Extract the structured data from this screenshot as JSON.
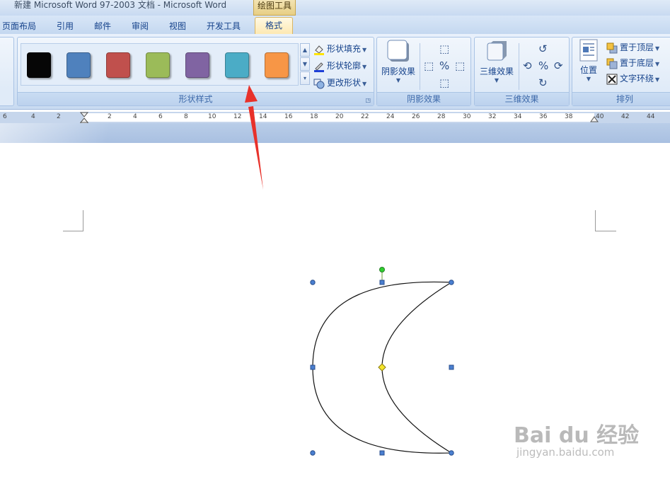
{
  "window": {
    "title": "新建 Microsoft Word 97-2003 文档 - Microsoft Word",
    "context_tool": "绘图工具"
  },
  "tabs": [
    {
      "label": "页面布局"
    },
    {
      "label": "引用"
    },
    {
      "label": "邮件"
    },
    {
      "label": "审阅"
    },
    {
      "label": "视图"
    },
    {
      "label": "开发工具"
    },
    {
      "label": "格式",
      "active": true
    }
  ],
  "ribbon": {
    "shape_styles": {
      "label": "形状样式",
      "swatches": [
        {
          "name": "black",
          "color": "#060606"
        },
        {
          "name": "blue",
          "color": "#4f81bd"
        },
        {
          "name": "red",
          "color": "#c0504d"
        },
        {
          "name": "green",
          "color": "#9bbb59"
        },
        {
          "name": "purple",
          "color": "#8064a2"
        },
        {
          "name": "aqua",
          "color": "#4bacc6"
        },
        {
          "name": "orange",
          "color": "#f79646"
        }
      ],
      "fill": "形状填充",
      "outline": "形状轮廓",
      "change_shape": "更改形状"
    },
    "shadow": {
      "label": "阴影效果",
      "button": "阴影效果"
    },
    "threed": {
      "label": "三维效果",
      "button": "三维效果"
    },
    "arrange": {
      "label": "排列",
      "position": "位置",
      "bring_front": "置于顶层",
      "send_back": "置于底层",
      "text_wrap": "文字环绕"
    }
  },
  "ruler": {
    "left_labels": [
      "6",
      "4",
      "2"
    ],
    "labels": [
      "2",
      "4",
      "6",
      "8",
      "10",
      "12",
      "14",
      "16",
      "18",
      "20",
      "22",
      "24",
      "26",
      "28",
      "30",
      "32",
      "34",
      "36",
      "38",
      "40",
      "42",
      "44"
    ]
  },
  "watermark": {
    "brand": "Bai du 经验",
    "url": "jingyan.baidu.com"
  },
  "colors": {
    "annotation_arrow": "#e8312a",
    "handle": "#4a7fd0",
    "rotate_handle": "#2fcf2f",
    "adjust_handle": "#f5e52c"
  }
}
